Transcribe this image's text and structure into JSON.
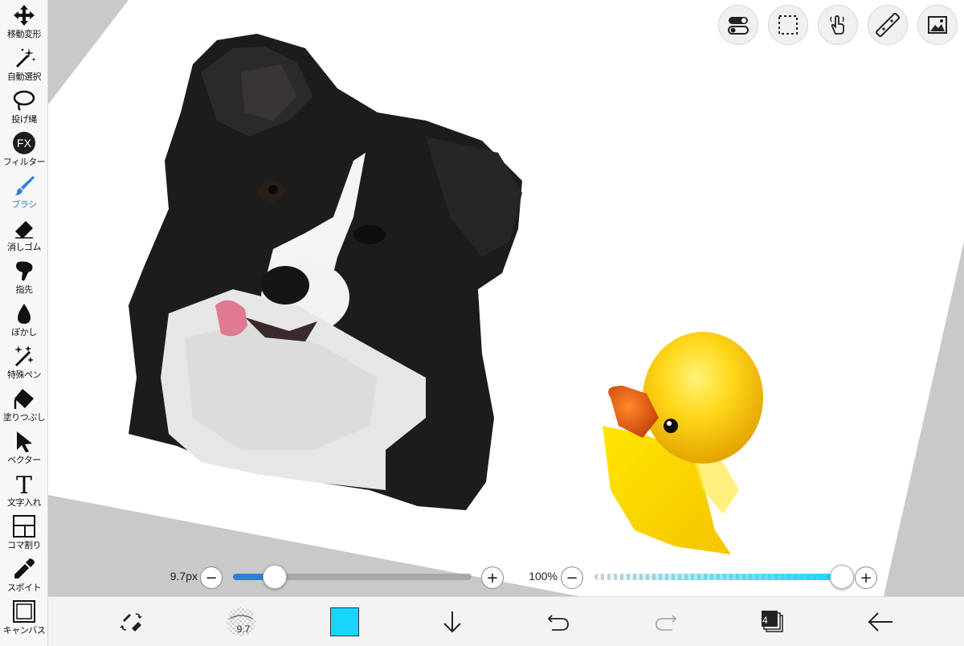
{
  "tools": [
    {
      "label": "移動変形",
      "icon": "move-arrows-icon"
    },
    {
      "label": "自動選択",
      "icon": "magic-wand-icon"
    },
    {
      "label": "投げ縄",
      "icon": "lasso-icon"
    },
    {
      "label": "フィルター",
      "icon": "fx-icon",
      "fx_text": "FX"
    },
    {
      "label": "ブラシ",
      "icon": "brush-icon",
      "active": true
    },
    {
      "label": "消しゴム",
      "icon": "eraser-icon"
    },
    {
      "label": "指先",
      "icon": "smudge-finger-icon"
    },
    {
      "label": "ぼかし",
      "icon": "blur-drop-icon"
    },
    {
      "label": "特殊ペン",
      "icon": "special-pen-icon"
    },
    {
      "label": "塗りつぶし",
      "icon": "fill-bucket-icon"
    },
    {
      "label": "ベクター",
      "icon": "vector-arrow-icon"
    },
    {
      "label": "文字入れ",
      "icon": "text-T-icon",
      "glyph": "T"
    },
    {
      "label": "コマ割り",
      "icon": "frame-divider-icon"
    },
    {
      "label": "スポイト",
      "icon": "eyedropper-icon"
    },
    {
      "label": "キャンバス",
      "icon": "canvas-icon"
    }
  ],
  "top_buttons": [
    "toggle-switches-icon",
    "selection-rect-icon",
    "hand-touch-icon",
    "ruler-icon",
    "image-layer-icon"
  ],
  "brush": {
    "size_label": "9.7px",
    "size_fraction": 0.175,
    "thumb_number": "9.7"
  },
  "opacity": {
    "label": "100%",
    "value_fraction": 1.0
  },
  "colors": {
    "accent": "#2f7fd6",
    "current_color": "#17d5fb",
    "opacity_track": "#17d5fb"
  },
  "layers": {
    "count": "4"
  },
  "bottom_buttons": [
    "swap-brush-eraser-icon",
    "brush-thumbnail-icon",
    "current-color-swatch",
    "down-arrow-icon",
    "undo-icon",
    "redo-icon",
    "layers-icon",
    "back-arrow-icon"
  ]
}
